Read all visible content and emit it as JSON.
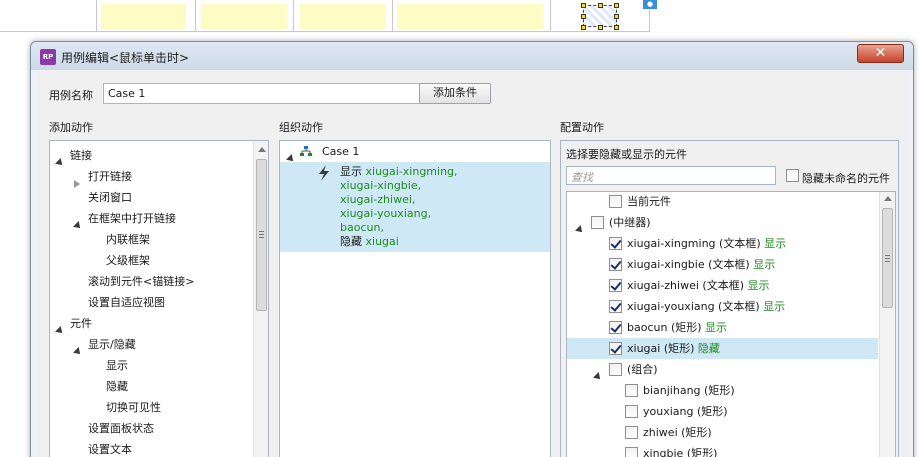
{
  "dialog": {
    "title": "用例编辑<鼠标单击时>",
    "app_icon": "RP",
    "close_glyph": "✕"
  },
  "case_name_label": "用例名称",
  "case_name_value": "Case 1",
  "add_condition_label": "添加条件",
  "add_action": {
    "heading": "添加动作",
    "items": [
      {
        "label": "链接",
        "level": 0,
        "expander": "down"
      },
      {
        "label": "打开链接",
        "level": 1,
        "expander": "right"
      },
      {
        "label": "关闭窗口",
        "level": 1,
        "expander": "none"
      },
      {
        "label": "在框架中打开链接",
        "level": 1,
        "expander": "down"
      },
      {
        "label": "内联框架",
        "level": 2,
        "expander": "none"
      },
      {
        "label": "父级框架",
        "level": 2,
        "expander": "none"
      },
      {
        "label": "滚动到元件<锚链接>",
        "level": 1,
        "expander": "none"
      },
      {
        "label": "设置自适应视图",
        "level": 1,
        "expander": "none"
      },
      {
        "label": "元件",
        "level": 0,
        "expander": "down"
      },
      {
        "label": "显示/隐藏",
        "level": 1,
        "expander": "down"
      },
      {
        "label": "显示",
        "level": 2,
        "expander": "none"
      },
      {
        "label": "隐藏",
        "level": 2,
        "expander": "none"
      },
      {
        "label": "切换可见性",
        "level": 2,
        "expander": "none"
      },
      {
        "label": "设置面板状态",
        "level": 1,
        "expander": "none"
      },
      {
        "label": "设置文本",
        "level": 1,
        "expander": "none"
      }
    ]
  },
  "organize_action": {
    "heading": "组织动作",
    "case_label": "Case 1",
    "show_prefix": "显示",
    "show_targets": [
      "xiugai-xingming,",
      "xiugai-xingbie,",
      "xiugai-zhiwei,",
      "xiugai-youxiang,",
      "baocun,"
    ],
    "hide_prefix": "隐藏",
    "hide_target": "xiugai"
  },
  "configure_action": {
    "heading": "配置动作",
    "subheading": "选择要隐藏或显示的元件",
    "search_placeholder": "查找",
    "hide_unnamed_label": "隐藏未命名的元件",
    "rows": [
      {
        "label": "当前元件",
        "state": "",
        "checked": false,
        "indent": 1,
        "expander": "none",
        "selected": false
      },
      {
        "label": "(中继器)",
        "state": "",
        "checked": false,
        "indent": 0,
        "expander": "down",
        "selected": false
      },
      {
        "label": "xiugai-xingming (文本框)",
        "state": "显示",
        "checked": true,
        "indent": 1,
        "expander": "none",
        "selected": false
      },
      {
        "label": "xiugai-xingbie (文本框)",
        "state": "显示",
        "checked": true,
        "indent": 1,
        "expander": "none",
        "selected": false
      },
      {
        "label": "xiugai-zhiwei (文本框)",
        "state": "显示",
        "checked": true,
        "indent": 1,
        "expander": "none",
        "selected": false
      },
      {
        "label": "xiugai-youxiang (文本框)",
        "state": "显示",
        "checked": true,
        "indent": 1,
        "expander": "none",
        "selected": false
      },
      {
        "label": "baocun (矩形)",
        "state": "显示",
        "checked": true,
        "indent": 1,
        "expander": "none",
        "selected": false
      },
      {
        "label": "xiugai (矩形)",
        "state": "隐藏",
        "checked": true,
        "indent": 1,
        "expander": "none",
        "selected": true
      },
      {
        "label": "(组合)",
        "state": "",
        "checked": false,
        "indent": 1,
        "expander": "down",
        "selected": false
      },
      {
        "label": "bianjihang (矩形)",
        "state": "",
        "checked": false,
        "indent": 2,
        "expander": "none",
        "selected": false
      },
      {
        "label": "youxiang (矩形)",
        "state": "",
        "checked": false,
        "indent": 2,
        "expander": "none",
        "selected": false
      },
      {
        "label": "zhiwei (矩形)",
        "state": "",
        "checked": false,
        "indent": 2,
        "expander": "none",
        "selected": false
      },
      {
        "label": "xingbie (矩形)",
        "state": "",
        "checked": false,
        "indent": 2,
        "expander": "none",
        "selected": false
      }
    ]
  },
  "colors": {
    "state_green": "#1f8a1f",
    "selection": "#cfe8f6",
    "title_icon": "#8a3aa3",
    "close_red": "#c7432a"
  }
}
